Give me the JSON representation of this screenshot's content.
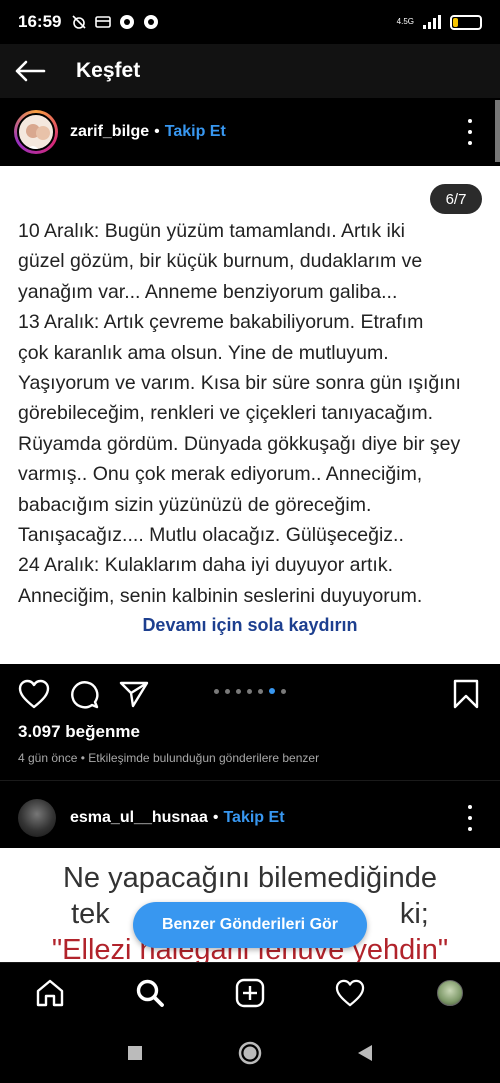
{
  "status_bar": {
    "time": "16:59",
    "network": "4.5G",
    "battery": "17",
    "battery_fraction": 0.17
  },
  "header": {
    "title": "Keşfet"
  },
  "post": {
    "username": "zarif_bilge",
    "separator": "•",
    "follow_label": "Takip Et",
    "page_indicator": "6/7",
    "text_lines": [
      "10 Aralık: Bugün yüzüm tamamlandı. Artık iki",
      "güzel gözüm, bir küçük burnum, dudaklarım ve",
      "yanağım var... Anneme benziyorum galiba...",
      "13 Aralık: Artık çevreme bakabiliyorum. Etrafım",
      "çok karanlık ama olsun. Yine de mutluyum.",
      "Yaşıyorum ve varım. Kısa bir süre sonra gün ışığını",
      "görebileceğim, renkleri ve çiçekleri tanıyacağım.",
      "Rüyamda gördüm. Dünyada gökkuşağı diye bir şey",
      "varmış.. Onu çok merak ediyorum.. Anneciğim,",
      "babacığım sizin yüzünüzü de göreceğim.",
      "Tanışacağız.... Mutlu olacağız. Gülüşeceğiz..",
      "24 Aralık: Kulaklarım daha iyi duyuyor artık.",
      "Anneciğim, senin kalbinin seslerini duyuyorum."
    ],
    "swipe_hint": "Devamı için sola kaydırın",
    "likes": "3.097 beğenme",
    "meta": "4 gün önce • Etkileşimde bulunduğun gönderilere benzer",
    "carousel_total": 7,
    "carousel_active": 6
  },
  "next_post": {
    "username": "esma_ul__husnaa",
    "separator": "•",
    "follow_label": "Takip Et",
    "image_line1": "Ne yapacağını bilemediğinde",
    "image_line2": "tek                                    ki;",
    "image_line3": "\"Ellezi halegani fehuve yehdin\""
  },
  "similar_button": "Benzer Gönderileri Gör",
  "icons": {
    "back": "arrow-left-icon",
    "like": "heart-icon",
    "comment": "comment-icon",
    "share": "send-icon",
    "save": "bookmark-icon",
    "home": "home-icon",
    "search": "search-icon",
    "create": "plus-square-icon",
    "activity": "heart-icon"
  },
  "colors": {
    "accent": "#3897f0",
    "swipe_hint": "#1d3f8f",
    "quote_red": "#b1232b"
  }
}
